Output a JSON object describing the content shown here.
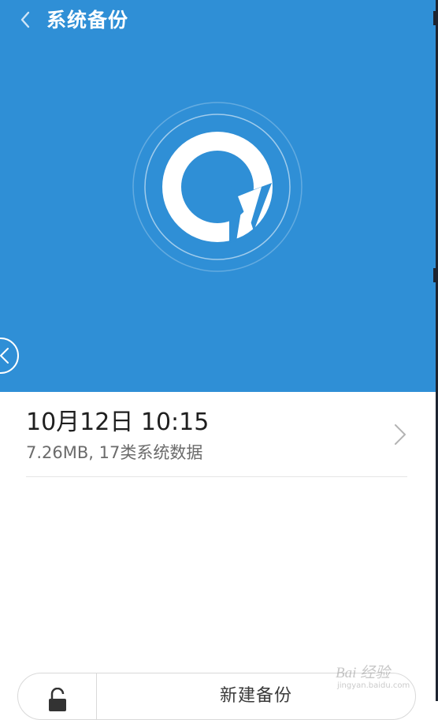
{
  "header": {
    "title": "系统备份",
    "back_icon": "chevron-left-icon"
  },
  "hero": {
    "background_color": "#2f8fd6",
    "logo_icon": "backup-logo-icon"
  },
  "backups": [
    {
      "time": "10月12日 10:15",
      "meta": "7.26MB, 17类系统数据",
      "chevron_icon": "chevron-right-icon"
    }
  ],
  "bottom_bar": {
    "lock_icon": "unlock-icon",
    "new_backup_label": "新建备份"
  },
  "watermark": {
    "text": "Bai 经验",
    "url": "jingyan.baidu.com"
  }
}
